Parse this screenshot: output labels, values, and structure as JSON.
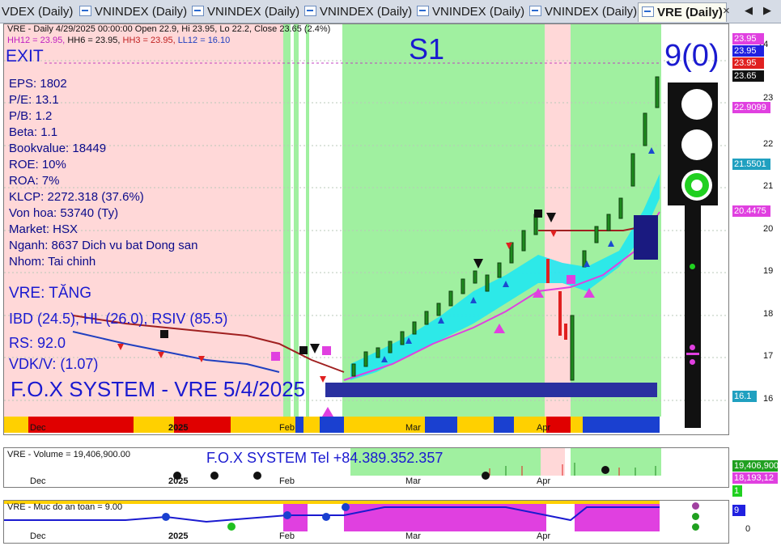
{
  "tabs": [
    {
      "label": "VDEX (Daily)"
    },
    {
      "label": "VNINDEX (Daily)"
    },
    {
      "label": "VNINDEX (Daily)"
    },
    {
      "label": "VNINDEX (Daily)"
    },
    {
      "label": "VNINDEX (Daily)"
    },
    {
      "label": "VNINDEX (Daily)"
    },
    {
      "label": "VRE (Daily)"
    }
  ],
  "tab_close": "×",
  "nav_left": "◀",
  "nav_right": "▶",
  "main": {
    "header_line": "VRE - Daily 4/29/2025 00:00:00 Open 22.9, Hi 23.95, Lo 22.2, Close 23.65 (2.4%)",
    "hh12": "HH12 = 23.95,",
    "hh6": "HH6 = 23.95,",
    "hh3": "HH3 = 23.95,",
    "ll12": "LL12 = 16.10",
    "exit": "EXIT",
    "s1": "S1",
    "signal": "9(0)",
    "fundamentals": [
      "EPS: 1802",
      "P/E: 13.1",
      "P/B: 1.2",
      "Beta: 1.1",
      "Bookvalue: 18449",
      "ROE: 10%",
      "ROA: 7%",
      "KLCP: 2272.318 (37.6%)",
      "Von hoa: 53740 (Ty)",
      "Market: HSX",
      "Nganh: 8637 Dich vu bat Dong san",
      "Nhom: Tai chinh"
    ],
    "trend": "VRE: TĂNG",
    "ibd": "IBD (24.5), HL (26.0), RSIV (85.5)",
    "rs": "RS: 92.0",
    "vdk": "VDK/V:  (1.07)",
    "banner": "F.O.X SYSTEM - VRE 5/4/2025",
    "price_tags": [
      {
        "text": "23.95",
        "color": "#e040e0"
      },
      {
        "text": "23.95",
        "color": "#2020e0"
      },
      {
        "text": "23.95",
        "color": "#e02020"
      },
      {
        "text": "23.65",
        "color": "#111111"
      },
      {
        "text": "22.9099",
        "color": "#e040e0"
      },
      {
        "text": "21.5501",
        "color": "#20a0c0"
      },
      {
        "text": "20.4475",
        "color": "#e040e0"
      },
      {
        "text": "16.1",
        "color": "#20a0c0"
      }
    ],
    "y_ticks": [
      "24",
      "23",
      "22",
      "21",
      "20",
      "19",
      "18",
      "17",
      "16"
    ],
    "months": [
      "Dec",
      "2025",
      "Feb",
      "Mar",
      "Apr"
    ]
  },
  "volume": {
    "header": "VRE - Volume = 19,406,900.00",
    "banner": "F.O.X SYSTEM Tel +84.389.352.357",
    "tag1": "19,406,900",
    "tag2": "18,193,12",
    "tag3": "1"
  },
  "safety": {
    "header": "VRE - Muc do an toan = 9.00",
    "tag": "9",
    "tick0": "0"
  },
  "colors": {
    "green_zone": "#a0f0a0",
    "red_zone": "#ffd8d8",
    "cyan_band": "#20e8f0",
    "navy": "#1a1a80",
    "magenta": "#e040e0"
  }
}
